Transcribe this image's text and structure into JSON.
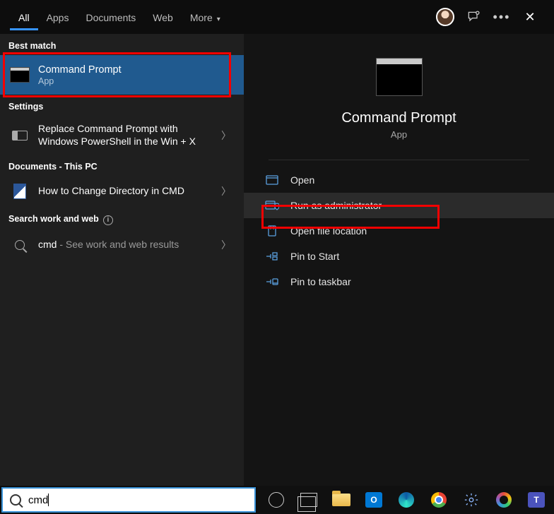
{
  "tabs": {
    "all": "All",
    "apps": "Apps",
    "documents": "Documents",
    "web": "Web",
    "more": "More"
  },
  "sections": {
    "best_match": "Best match",
    "settings": "Settings",
    "documents": "Documents - This PC",
    "search_web": "Search work and web"
  },
  "best_match": {
    "title": "Command Prompt",
    "sub": "App"
  },
  "setting_item": "Replace Command Prompt with Windows PowerShell in the Win + X",
  "doc_item": "How to Change Directory in CMD",
  "web_item_prefix": "cmd",
  "web_item_suffix": " - See work and web results",
  "detail": {
    "name": "Command Prompt",
    "type": "App"
  },
  "actions": {
    "open": "Open",
    "run_admin": "Run as administrator",
    "open_loc": "Open file location",
    "pin_start": "Pin to Start",
    "pin_taskbar": "Pin to taskbar"
  },
  "search_value": "cmd"
}
